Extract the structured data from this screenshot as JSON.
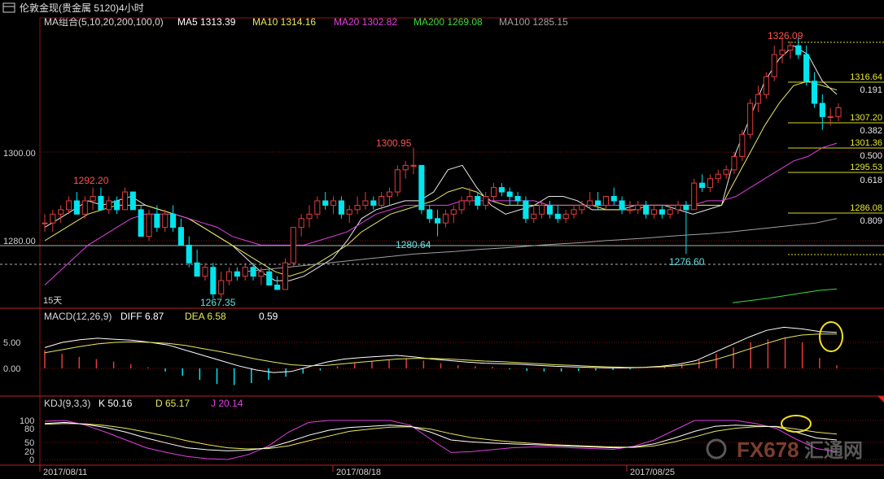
{
  "window": {
    "title": "伦敦金现(贵金属 5120)4小时"
  },
  "colors": {
    "up": "#e03c3c",
    "down": "#00e5ee",
    "ma5": "#e8e8e8",
    "ma10": "#e8e860",
    "ma20": "#e040e0",
    "ma200": "#3cdc3c",
    "ma100": "#a0a0a0",
    "grid": "#7a1010",
    "fib": "#d8d820",
    "bg": "#000000"
  },
  "legend": {
    "ma_group": "MA组合(5,10,20,200,100,0)",
    "ma5": "MA5 1313.39",
    "ma10": "MA10 1314.16",
    "ma20": "MA20 1302.82",
    "ma200": "MA200 1269.08",
    "ma100": "MA100 1285.15",
    "macd": "MACD(12,26,9)",
    "diff": "DIFF  6.87",
    "dea": "DEA  6.58",
    "macd_val": "0.59",
    "kdj": "KDJ(9,3,3)",
    "k": "K  50.16",
    "d": "D  65.17",
    "j": "J  20.14",
    "days": "15天"
  },
  "watermark": {
    "brand": "FX678",
    "cn": "汇通网"
  },
  "chart_data": {
    "type": "candlestick",
    "title": "伦敦金现(贵金属 5120)4小时",
    "xlabel": "",
    "ylabel": "",
    "ylim": [
      1266,
      1333
    ],
    "y_ticks": [
      "1300.00",
      "1280.00"
    ],
    "x_ticks": [
      "2017/08/11",
      "2017/08/18",
      "2017/08/25"
    ],
    "high_low_labels": [
      "1292.20",
      "1267.35",
      "1300.95",
      "1280.64",
      "1276.60",
      "1326.09"
    ],
    "fib_levels": [
      {
        "price": "1316.64",
        "ratio": "0.191"
      },
      {
        "price": "1307.20",
        "ratio": "0.382"
      },
      {
        "price": "1301.36",
        "ratio": "0.500"
      },
      {
        "price": "1295.53",
        "ratio": "0.618"
      },
      {
        "price": "1286.08",
        "ratio": "0.809"
      }
    ],
    "ohlc": [
      [
        1284,
        1286,
        1282,
        1284
      ],
      [
        1284,
        1287,
        1282,
        1286
      ],
      [
        1286,
        1288,
        1284,
        1287
      ],
      [
        1287,
        1290,
        1286,
        1289
      ],
      [
        1289,
        1291,
        1286,
        1286
      ],
      [
        1286,
        1290,
        1285,
        1289
      ],
      [
        1289,
        1292,
        1287,
        1290
      ],
      [
        1290,
        1292,
        1287,
        1287
      ],
      [
        1287,
        1290,
        1286,
        1289
      ],
      [
        1289,
        1290,
        1286,
        1287
      ],
      [
        1287,
        1292,
        1287,
        1291
      ],
      [
        1291,
        1291,
        1287,
        1287
      ],
      [
        1287,
        1288,
        1281,
        1281
      ],
      [
        1281,
        1287,
        1280,
        1286
      ],
      [
        1286,
        1288,
        1282,
        1283
      ],
      [
        1283,
        1287,
        1282,
        1286
      ],
      [
        1286,
        1288,
        1282,
        1283
      ],
      [
        1283,
        1285,
        1280,
        1279
      ],
      [
        1279,
        1281,
        1274,
        1275
      ],
      [
        1275,
        1278,
        1272,
        1272
      ],
      [
        1272,
        1275,
        1271,
        1274
      ],
      [
        1274,
        1275,
        1267,
        1268
      ],
      [
        1268,
        1273,
        1267,
        1271
      ],
      [
        1271,
        1274,
        1270,
        1273
      ],
      [
        1273,
        1274,
        1271,
        1272
      ],
      [
        1272,
        1275,
        1271,
        1274
      ],
      [
        1274,
        1275,
        1271,
        1272
      ],
      [
        1272,
        1274,
        1270,
        1273
      ],
      [
        1273,
        1274,
        1270,
        1270
      ],
      [
        1270,
        1272,
        1269,
        1269
      ],
      [
        1269,
        1276,
        1269,
        1275
      ],
      [
        1275,
        1283,
        1274,
        1283
      ],
      [
        1283,
        1286,
        1281,
        1285
      ],
      [
        1285,
        1288,
        1283,
        1286
      ],
      [
        1286,
        1290,
        1285,
        1289
      ],
      [
        1289,
        1291,
        1287,
        1288
      ],
      [
        1288,
        1290,
        1286,
        1289
      ],
      [
        1289,
        1290,
        1285,
        1286
      ],
      [
        1286,
        1288,
        1284,
        1287
      ],
      [
        1287,
        1290,
        1286,
        1288
      ],
      [
        1288,
        1291,
        1287,
        1289
      ],
      [
        1289,
        1290,
        1287,
        1288
      ],
      [
        1288,
        1291,
        1287,
        1290
      ],
      [
        1290,
        1292,
        1288,
        1291
      ],
      [
        1291,
        1297,
        1290,
        1296
      ],
      [
        1296,
        1298,
        1294,
        1297
      ],
      [
        1297,
        1301,
        1295,
        1297
      ],
      [
        1297,
        1297,
        1286,
        1287
      ],
      [
        1287,
        1288,
        1284,
        1285
      ],
      [
        1285,
        1287,
        1281,
        1284
      ],
      [
        1284,
        1287,
        1283,
        1286
      ],
      [
        1286,
        1288,
        1284,
        1287
      ],
      [
        1287,
        1290,
        1286,
        1289
      ],
      [
        1289,
        1292,
        1288,
        1290
      ],
      [
        1290,
        1291,
        1287,
        1288
      ],
      [
        1288,
        1291,
        1287,
        1290
      ],
      [
        1290,
        1293,
        1289,
        1292
      ],
      [
        1292,
        1293,
        1290,
        1291
      ],
      [
        1291,
        1292,
        1288,
        1290
      ],
      [
        1290,
        1291,
        1288,
        1289
      ],
      [
        1289,
        1290,
        1284,
        1285
      ],
      [
        1285,
        1288,
        1284,
        1286
      ],
      [
        1286,
        1289,
        1285,
        1288
      ],
      [
        1288,
        1289,
        1285,
        1286
      ],
      [
        1286,
        1288,
        1284,
        1285
      ],
      [
        1285,
        1287,
        1284,
        1286
      ],
      [
        1286,
        1288,
        1285,
        1287
      ],
      [
        1287,
        1289,
        1286,
        1288
      ],
      [
        1288,
        1291,
        1287,
        1289
      ],
      [
        1289,
        1291,
        1287,
        1288
      ],
      [
        1288,
        1290,
        1287,
        1290
      ],
      [
        1290,
        1292,
        1288,
        1289
      ],
      [
        1289,
        1290,
        1286,
        1287
      ],
      [
        1287,
        1289,
        1286,
        1287
      ],
      [
        1287,
        1289,
        1286,
        1288
      ],
      [
        1288,
        1289,
        1285,
        1286
      ],
      [
        1286,
        1288,
        1285,
        1287
      ],
      [
        1287,
        1288,
        1285,
        1286
      ],
      [
        1286,
        1288,
        1285,
        1287
      ],
      [
        1287,
        1289,
        1286,
        1288
      ],
      [
        1288,
        1289,
        1277,
        1287
      ],
      [
        1287,
        1294,
        1287,
        1293
      ],
      [
        1293,
        1295,
        1291,
        1292
      ],
      [
        1292,
        1295,
        1291,
        1294
      ],
      [
        1294,
        1296,
        1293,
        1295
      ],
      [
        1295,
        1297,
        1294,
        1296
      ],
      [
        1296,
        1300,
        1295,
        1299
      ],
      [
        1299,
        1305,
        1298,
        1304
      ],
      [
        1304,
        1312,
        1303,
        1311
      ],
      [
        1311,
        1315,
        1309,
        1313
      ],
      [
        1313,
        1318,
        1312,
        1317
      ],
      [
        1317,
        1324,
        1316,
        1322
      ],
      [
        1322,
        1326,
        1320,
        1323
      ],
      [
        1323,
        1325,
        1321,
        1324
      ],
      [
        1324,
        1326,
        1321,
        1322
      ],
      [
        1322,
        1324,
        1315,
        1316
      ],
      [
        1316,
        1318,
        1310,
        1311
      ],
      [
        1311,
        1313,
        1305,
        1308
      ],
      [
        1308,
        1310,
        1306,
        1308
      ],
      [
        1308,
        1311,
        1307,
        1310
      ]
    ],
    "ma_series": [
      {
        "name": "MA5",
        "values": [
          1283,
          1285,
          1287,
          1289,
          1288,
          1289,
          1290,
          1288,
          1287,
          1286,
          1285,
          1283,
          1281,
          1279,
          1276,
          1273,
          1271,
          1271,
          1272,
          1274,
          1276,
          1280,
          1285,
          1287,
          1288,
          1289,
          1289,
          1291,
          1296,
          1297,
          1292,
          1288,
          1286,
          1287,
          1288,
          1290,
          1290,
          1289,
          1287,
          1287,
          1287,
          1288,
          1288,
          1288,
          1287,
          1286,
          1287,
          1288,
          1300,
          1308,
          1316,
          1321,
          1324,
          1322,
          1316,
          1313
        ]
      },
      {
        "name": "MA10",
        "values": [
          1280,
          1282,
          1284,
          1286,
          1287,
          1288,
          1288,
          1288,
          1287,
          1286,
          1285,
          1283,
          1281,
          1279,
          1277,
          1275,
          1273,
          1272,
          1273,
          1275,
          1277,
          1279,
          1282,
          1284,
          1286,
          1287,
          1288,
          1289,
          1291,
          1292,
          1291,
          1289,
          1288,
          1288,
          1288,
          1288,
          1288,
          1288,
          1288,
          1287,
          1287,
          1287,
          1288,
          1288,
          1288,
          1288,
          1288,
          1288,
          1294,
          1300,
          1306,
          1311,
          1315,
          1316,
          1315,
          1314
        ]
      },
      {
        "name": "MA20",
        "values": [
          1270,
          1273,
          1276,
          1279,
          1281,
          1283,
          1285,
          1286,
          1286,
          1286,
          1285,
          1284,
          1283,
          1281,
          1280,
          1279,
          1279,
          1279,
          1279,
          1280,
          1281,
          1282,
          1284,
          1286,
          1287,
          1288,
          1288,
          1288,
          1288,
          1289,
          1289,
          1289,
          1289,
          1289,
          1289,
          1288,
          1288,
          1288,
          1288,
          1288,
          1288,
          1288,
          1288,
          1288,
          1288,
          1288,
          1289,
          1289,
          1290,
          1292,
          1294,
          1296,
          1298,
          1299,
          1301,
          1302
        ]
      },
      {
        "name": "MA100",
        "values": [
          1273,
          1273.5,
          1274,
          1274.5,
          1275,
          1275.5,
          1276,
          1276.5,
          1277,
          1277.3,
          1277.6,
          1278,
          1278.3,
          1278.6,
          1279,
          1279.3,
          1279.6,
          1280,
          1280.3,
          1280.6,
          1281,
          1281.3,
          1281.6,
          1282,
          1282.5,
          1283,
          1283.5,
          1284,
          1285
        ]
      },
      {
        "name": "MA200",
        "values": [
          1266,
          1266.5,
          1267,
          1267.6,
          1268.2,
          1268.8,
          1269.1
        ]
      }
    ],
    "macd": {
      "diff": [
        4,
        5,
        5.5,
        5.8,
        5.6,
        5.4,
        5,
        4.5,
        3.5,
        2.5,
        1.5,
        0.5,
        -0.3,
        -0.8,
        -0.6,
        0.3,
        1.2,
        1.8,
        2.1,
        2.3,
        2.5,
        2.2,
        1.8,
        1.5,
        1.2,
        1,
        0.9,
        0.8,
        0.6,
        0.4,
        0.3,
        0.2,
        0.1,
        0.1,
        0.2,
        0.4,
        0.8,
        1.5,
        3,
        4.5,
        6,
        7.3,
        7.9,
        7.6,
        7.1,
        6.9
      ],
      "dea": [
        3,
        3.6,
        4.2,
        4.7,
        5,
        5.1,
        5,
        4.8,
        4.4,
        3.8,
        3.2,
        2.5,
        1.8,
        1.2,
        0.7,
        0.5,
        0.6,
        0.9,
        1.2,
        1.5,
        1.8,
        1.9,
        1.9,
        1.8,
        1.6,
        1.4,
        1.3,
        1.1,
        0.9,
        0.7,
        0.6,
        0.4,
        0.3,
        0.2,
        0.2,
        0.3,
        0.5,
        0.9,
        1.6,
        2.6,
        3.7,
        4.8,
        5.8,
        6.4,
        6.6,
        6.6
      ],
      "hist": [
        3.5,
        2.8,
        2.2,
        1.8,
        1.3,
        0.8,
        0.2,
        -0.6,
        -1.4,
        -2.2,
        -3,
        -3.2,
        -2.8,
        -2.2,
        -1.6,
        -1,
        -0.4,
        0.4,
        1,
        1.4,
        1.6,
        1.8,
        1.5,
        1,
        0.6,
        0.4,
        0.3,
        -0.2,
        -0.5,
        -0.6,
        -0.6,
        -0.5,
        -0.4,
        -0.3,
        -0.2,
        0.1,
        0.4,
        0.8,
        1.6,
        2.8,
        4,
        5,
        5.6,
        5.9,
        5,
        2,
        0.6
      ]
    },
    "kdj": {
      "k": [
        92,
        95,
        90,
        82,
        70,
        55,
        42,
        30,
        25,
        22,
        24,
        30,
        45,
        62,
        75,
        82,
        85,
        88,
        85,
        70,
        50,
        45,
        42,
        40,
        38,
        36,
        34,
        32,
        30,
        32,
        40,
        55,
        72,
        85,
        88,
        86,
        84,
        70,
        55,
        50
      ],
      "d": [
        90,
        92,
        91,
        87,
        80,
        70,
        60,
        48,
        38,
        30,
        27,
        28,
        35,
        48,
        60,
        72,
        78,
        83,
        84,
        78,
        66,
        56,
        50,
        45,
        41,
        38,
        36,
        34,
        32,
        31,
        35,
        45,
        58,
        72,
        80,
        84,
        85,
        78,
        70,
        65
      ],
      "j": [
        98,
        100,
        88,
        70,
        50,
        30,
        18,
        8,
        2,
        0,
        12,
        34,
        70,
        95,
        100,
        100,
        100,
        100,
        88,
        52,
        18,
        20,
        25,
        30,
        32,
        32,
        30,
        28,
        26,
        34,
        50,
        75,
        100,
        100,
        100,
        92,
        80,
        52,
        28,
        20
      ]
    }
  }
}
